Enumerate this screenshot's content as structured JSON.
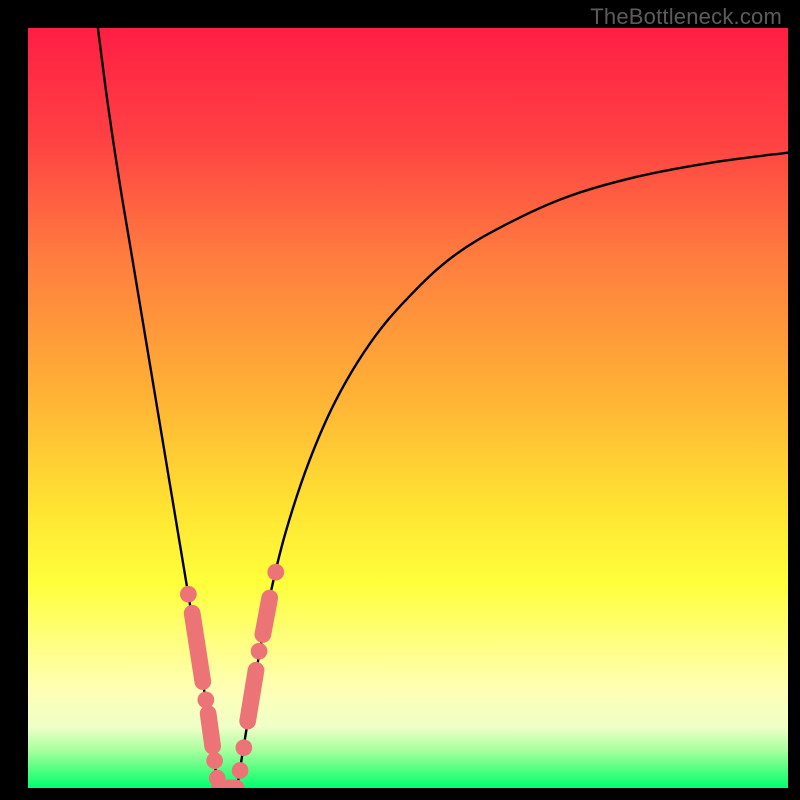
{
  "watermark": {
    "text": "TheBottleneck.com"
  },
  "colors": {
    "border": "#000000",
    "curve": "#000000",
    "marker_fill": "#ec7477",
    "marker_stroke": "#ec7477",
    "gradient_stops": [
      {
        "offset": 0.0,
        "color": "#ff1e44"
      },
      {
        "offset": 0.15,
        "color": "#ff4243"
      },
      {
        "offset": 0.3,
        "color": "#ff7c3f"
      },
      {
        "offset": 0.48,
        "color": "#ffb136"
      },
      {
        "offset": 0.63,
        "color": "#ffe332"
      },
      {
        "offset": 0.73,
        "color": "#ffff3a"
      },
      {
        "offset": 0.8,
        "color": "#ffff7a"
      },
      {
        "offset": 0.87,
        "color": "#ffffb5"
      },
      {
        "offset": 0.92,
        "color": "#eeffc7"
      },
      {
        "offset": 0.95,
        "color": "#aaff9f"
      },
      {
        "offset": 0.975,
        "color": "#55ff80"
      },
      {
        "offset": 1.0,
        "color": "#00ff72"
      }
    ]
  },
  "chart_data": {
    "type": "line",
    "title": "",
    "xlabel": "",
    "ylabel": "",
    "xlim": [
      0,
      100
    ],
    "ylim": [
      0,
      100
    ],
    "grid": false,
    "legend": false,
    "series": [
      {
        "name": "left-branch",
        "x": [
          9.2,
          10.5,
          12.0,
          13.5,
          15.0,
          16.5,
          18.0,
          19.0,
          20.0,
          21.0,
          22.0,
          23.0,
          23.6,
          24.2,
          24.6,
          25.0
        ],
        "y": [
          100.0,
          90.0,
          80.0,
          71.0,
          62.0,
          53.0,
          44.0,
          38.0,
          32.0,
          26.0,
          20.0,
          14.0,
          10.0,
          6.0,
          3.0,
          0.0
        ]
      },
      {
        "name": "valley-floor",
        "x": [
          25.0,
          25.8,
          26.6,
          27.5
        ],
        "y": [
          0.0,
          0.0,
          0.0,
          0.0
        ]
      },
      {
        "name": "right-branch",
        "x": [
          27.5,
          28.3,
          29.3,
          30.5,
          32.0,
          34.0,
          37.0,
          40.5,
          45.0,
          50.0,
          56.0,
          63.0,
          71.0,
          80.0,
          90.0,
          100.0
        ],
        "y": [
          0.0,
          5.0,
          11.0,
          18.0,
          26.0,
          34.0,
          43.0,
          51.0,
          58.5,
          64.5,
          70.0,
          74.2,
          77.8,
          80.4,
          82.3,
          83.6
        ]
      }
    ],
    "markers": [
      {
        "shape": "circle",
        "x": 21.1,
        "y": 25.5,
        "r": 1.1
      },
      {
        "shape": "capsule",
        "x1": 21.6,
        "y1": 23.0,
        "x2": 23.0,
        "y2": 14.0,
        "r": 1.1
      },
      {
        "shape": "circle",
        "x": 23.4,
        "y": 11.6,
        "r": 1.1
      },
      {
        "shape": "capsule",
        "x1": 23.7,
        "y1": 9.8,
        "x2": 24.3,
        "y2": 5.5,
        "r": 1.1
      },
      {
        "shape": "circle",
        "x": 24.55,
        "y": 3.6,
        "r": 1.1
      },
      {
        "shape": "circle",
        "x": 24.9,
        "y": 1.3,
        "r": 1.1
      },
      {
        "shape": "capsule",
        "x1": 25.2,
        "y1": 0.0,
        "x2": 27.4,
        "y2": 0.0,
        "r": 1.1
      },
      {
        "shape": "circle",
        "x": 27.9,
        "y": 2.3,
        "r": 1.1
      },
      {
        "shape": "circle",
        "x": 28.4,
        "y": 5.3,
        "r": 1.1
      },
      {
        "shape": "capsule",
        "x1": 28.9,
        "y1": 8.8,
        "x2": 30.0,
        "y2": 15.5,
        "r": 1.1
      },
      {
        "shape": "circle",
        "x": 30.4,
        "y": 18.0,
        "r": 1.1
      },
      {
        "shape": "capsule",
        "x1": 30.9,
        "y1": 20.2,
        "x2": 31.8,
        "y2": 25.0,
        "r": 1.1
      },
      {
        "shape": "circle",
        "x": 32.6,
        "y": 28.4,
        "r": 1.1
      }
    ]
  }
}
